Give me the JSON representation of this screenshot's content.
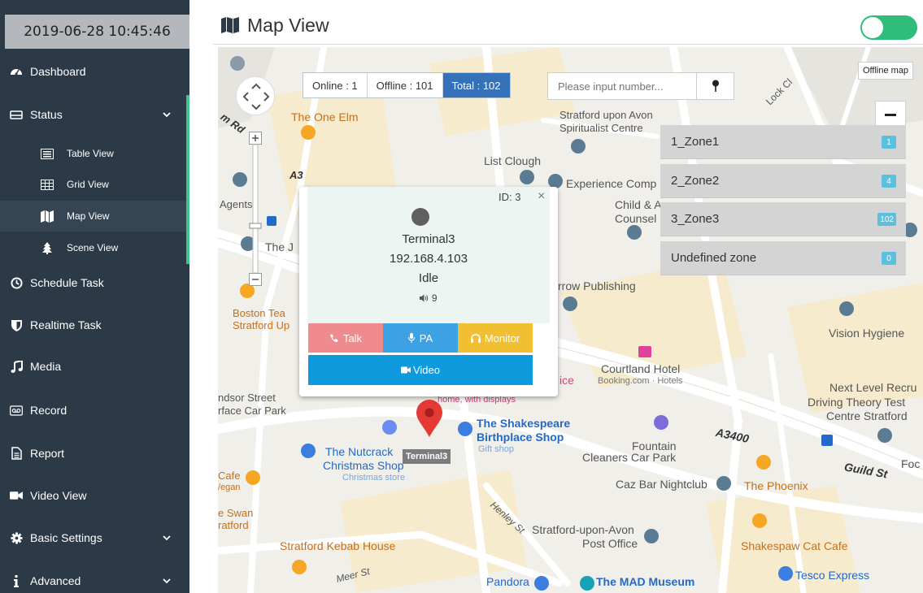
{
  "datetime": "2019-06-28 10:45:46",
  "sidebar": {
    "items": [
      {
        "label": "Dashboard",
        "icon": "dashboard-icon"
      },
      {
        "label": "Status",
        "icon": "hdd-icon",
        "expanded": true
      },
      {
        "label": "Schedule Task",
        "icon": "clock-icon"
      },
      {
        "label": "Realtime Task",
        "icon": "shield-icon"
      },
      {
        "label": "Media",
        "icon": "music-icon"
      },
      {
        "label": "Record",
        "icon": "voicemail-icon"
      },
      {
        "label": "Report",
        "icon": "file-text-icon"
      },
      {
        "label": "Video View",
        "icon": "video-camera-icon"
      },
      {
        "label": "Basic Settings",
        "icon": "cog-icon"
      },
      {
        "label": "Advanced",
        "icon": "info-icon"
      }
    ],
    "status_sub": [
      {
        "label": "Table View",
        "icon": "list-alt-icon"
      },
      {
        "label": "Grid View",
        "icon": "table-icon"
      },
      {
        "label": "Map View",
        "icon": "map-icon",
        "active": true
      },
      {
        "label": "Scene View",
        "icon": "tree-icon"
      }
    ]
  },
  "header": {
    "title": "Map View",
    "offline_toggle_on": true
  },
  "map": {
    "stats": {
      "online": "Online : 1",
      "offline": "Offline : 101",
      "total": "Total : 102"
    },
    "search_placeholder": "Please input number...",
    "offline_map_label": "Offline map",
    "zones": [
      {
        "name": "1_Zone1",
        "count": "1"
      },
      {
        "name": "2_Zone2",
        "count": "4"
      },
      {
        "name": "3_Zone3",
        "count": "102"
      },
      {
        "name": "Undefined zone",
        "count": "0"
      }
    ],
    "popup": {
      "id": "ID: 3",
      "close": "×",
      "name": "Terminal3",
      "ip": "192.168.4.103",
      "state": "Idle",
      "volume": "9",
      "talk": "Talk",
      "pa": "PA",
      "monitor": "Monitor",
      "video": "Video"
    },
    "marker_label": "Terminal3",
    "labels": {
      "the_one_elm": "The One Elm",
      "stratford_upon_avon": "Stratford upon Avon",
      "spiritualist_centre": "Spiritualist Centre",
      "list_clough": "List Clough",
      "experience_comp": "Experience Comp",
      "child": "Child & A",
      "counsel": "Counsel",
      "agents": "Agents",
      "the_j": "The J",
      "boston_tea": "Boston Tea",
      "stratford_up": "Stratford Up",
      "arrow_publishing": "rrow Publishing",
      "vision_hygiene": "Vision Hygiene",
      "courtland_hotel": "Courtland Hotel",
      "booking": "Booking.com · Hotels",
      "next_level": "Next Level Recru",
      "driving_theory": "Driving Theory Test",
      "centre_stratford": "Centre Stratford",
      "windsor_street": "ndsor Street",
      "surface_car_park": "rface Car Park",
      "home_displays": "home, with displays",
      "shakespeare": "The Shakespeare",
      "birthplace": "Birthplace Shop",
      "gift_shop": "Gift shop",
      "nutcracker": "The Nutcrack",
      "christmas_shop": "Christmas Shop",
      "christmas_store": "Christmas store",
      "fountain": "Fountain",
      "cleaners": "Cleaners Car Park",
      "a3400": "A3400",
      "guild_st": "Guild St",
      "caz_bar": "Caz Bar Nightclub",
      "the_phoenix": "The Phoenix",
      "cafe": "Cafe",
      "vegan": "/egan",
      "swan": "e Swan",
      "ratford": "ratford",
      "henley_st": "Henley St",
      "post_office_1": "Stratford-upon-Avon",
      "post_office_2": "Post Office",
      "shakespaw": "Shakespaw Cat Cafe",
      "kebab": "Stratford Kebab House",
      "meer_st": "Meer St",
      "pandora": "Pandora",
      "mad_museum": "The MAD Museum",
      "tesco": "Tesco Express",
      "lock_cl": "Lock Cl",
      "rm_rd": "m Rd",
      "a3": "A3",
      "foc": "Foc",
      "ice": "ice"
    }
  },
  "colors": {
    "sidebar_bg": "#2c3a47",
    "accent_green": "#3ec58c",
    "total_blue": "#3571b9",
    "talk": "#ef8a8e",
    "pa": "#3da2e3",
    "monitor": "#f0c032",
    "video": "#0f9ade"
  }
}
